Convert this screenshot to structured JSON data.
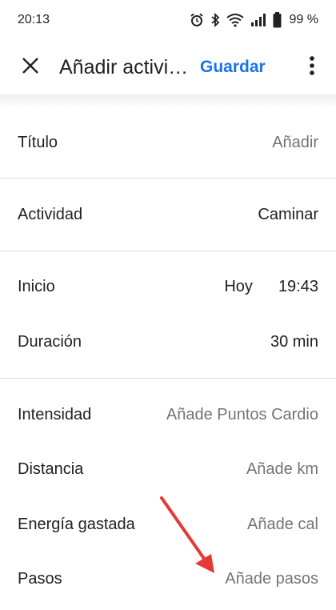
{
  "status_bar": {
    "time": "20:13",
    "battery": "99 %",
    "icons": [
      "alarm-icon",
      "bluetooth-icon",
      "wifi-icon",
      "signal-icon",
      "battery-icon"
    ]
  },
  "app_bar": {
    "close_icon": "close-icon",
    "title": "Añadir actividad",
    "save_label": "Guardar",
    "more_icon": "more-vert-icon"
  },
  "form": {
    "titulo": {
      "label": "Título",
      "value": "Añadir"
    },
    "actividad": {
      "label": "Actividad",
      "value": "Caminar"
    },
    "inicio": {
      "label": "Inicio",
      "date": "Hoy",
      "time": "19:43"
    },
    "duracion": {
      "label": "Duración",
      "value": "30 min"
    },
    "intensidad": {
      "label": "Intensidad",
      "value": "Añade Puntos Cardio"
    },
    "distancia": {
      "label": "Distancia",
      "value": "Añade km"
    },
    "energia": {
      "label": "Energía gastada",
      "value": "Añade cal"
    },
    "pasos": {
      "label": "Pasos",
      "value": "Añade pasos"
    }
  },
  "colors": {
    "accent": "#1a73e8",
    "text": "#202124",
    "placeholder": "#70757a",
    "divider": "#dadce0",
    "annotation": "#e53935"
  }
}
